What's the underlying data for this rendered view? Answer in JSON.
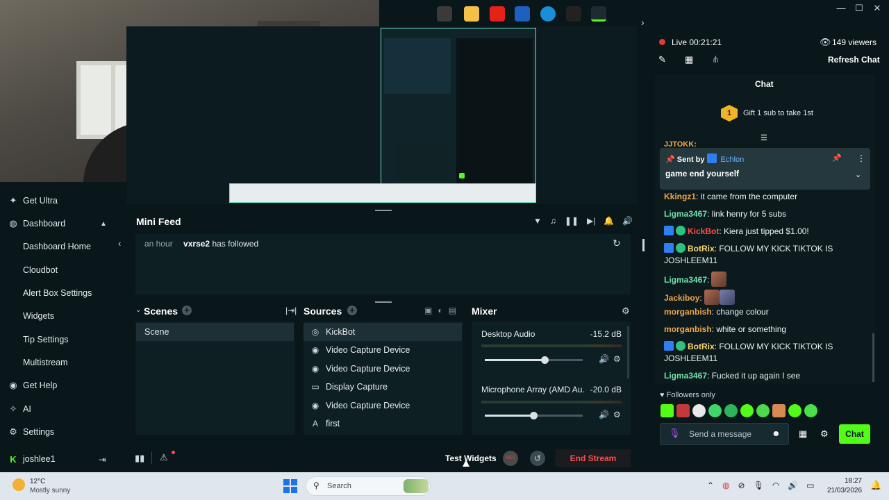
{
  "titlebar": {
    "minimize": "—",
    "maximize": "☐",
    "close": "✕"
  },
  "sidebar": {
    "items": [
      {
        "label": "Get Ultra",
        "icon": "sparkle-icon"
      },
      {
        "label": "Dashboard",
        "icon": "dashboard-icon"
      },
      {
        "label": "Dashboard Home"
      },
      {
        "label": "Cloudbot"
      },
      {
        "label": "Alert Box Settings"
      },
      {
        "label": "Widgets"
      },
      {
        "label": "Tip Settings"
      },
      {
        "label": "Multistream"
      },
      {
        "label": "Get Help",
        "icon": "help-icon"
      },
      {
        "label": "AI",
        "icon": "ai-icon"
      },
      {
        "label": "Settings",
        "icon": "gear-icon"
      }
    ],
    "user": "joshlee1"
  },
  "minifeed": {
    "title": "Mini Feed",
    "event_time": "an hour",
    "event_user": "vxrse2",
    "event_action": "has followed"
  },
  "scenes": {
    "title": "Scenes",
    "items": [
      "Scene"
    ]
  },
  "sources": {
    "title": "Sources",
    "items": [
      {
        "label": "KickBot",
        "icon": "globe-icon"
      },
      {
        "label": "Video Capture Device",
        "icon": "webcam-icon"
      },
      {
        "label": "Video Capture Device",
        "icon": "webcam-icon"
      },
      {
        "label": "Display Capture",
        "icon": "monitor-icon"
      },
      {
        "label": "Video Capture Device",
        "icon": "webcam-icon"
      },
      {
        "label": "first",
        "icon": "text-icon"
      }
    ]
  },
  "mixer": {
    "title": "Mixer",
    "channels": [
      {
        "label": "Desktop Audio",
        "db": "-15.2 dB",
        "level": 0.62
      },
      {
        "label": "Microphone Array (AMD Au...",
        "db": "-20.0 dB",
        "level": 0.5
      }
    ]
  },
  "bottombar": {
    "test_widgets": "Test Widgets",
    "rec": "REC",
    "end_stream": "End Stream"
  },
  "stream": {
    "status": "Live",
    "timer": "00:21:21",
    "viewers": "149 viewers",
    "refresh": "Refresh Chat"
  },
  "chat": {
    "title": "Chat",
    "gift_count": "1",
    "gift_text": "Gift 1 sub to take 1st",
    "partial_user": "JJTOKK:",
    "pinned": {
      "sent_by": "Sent by",
      "author": "Echlon",
      "message": "game end yourself"
    },
    "messages": [
      {
        "user": "Kkingz1",
        "text": "it came from the computer",
        "color": "orange"
      },
      {
        "user": "Ligma3467",
        "text": "link henry for 5 subs",
        "color": "teal"
      },
      {
        "user": "KickBot",
        "text": "Kiera just tipped $1.00!",
        "color": "red"
      },
      {
        "user": "BotRix",
        "text": "FOLLOW MY KICK TIKTOK IS JOSHLEEM11",
        "color": "yellow"
      },
      {
        "user": "Ligma3467",
        "text": "",
        "color": "teal"
      },
      {
        "user": "Jackiboy",
        "text": "",
        "color": "orange"
      },
      {
        "user": "morganbish",
        "text": "change colour",
        "color": "orange"
      },
      {
        "user": "morganbish",
        "text": "white or something",
        "color": "orange"
      },
      {
        "user": "BotRix",
        "text": "FOLLOW MY KICK TIKTOK IS JOSHLEEM11",
        "color": "yellow"
      },
      {
        "user": "Ligma3467",
        "text": "Fucked it up again I see",
        "color": "teal"
      }
    ],
    "followers_only": "Followers only",
    "input_placeholder": "Send a message",
    "send_button": "Chat"
  },
  "taskbar": {
    "weather_temp": "12°C",
    "weather_desc": "Mostly sunny",
    "search": "Search",
    "time": "18:27",
    "date": "21/03/2026"
  },
  "colors": {
    "kick_green": "#53fc18",
    "end_stream": "#ff4d4d",
    "accent_teal": "#6fe3c7"
  }
}
